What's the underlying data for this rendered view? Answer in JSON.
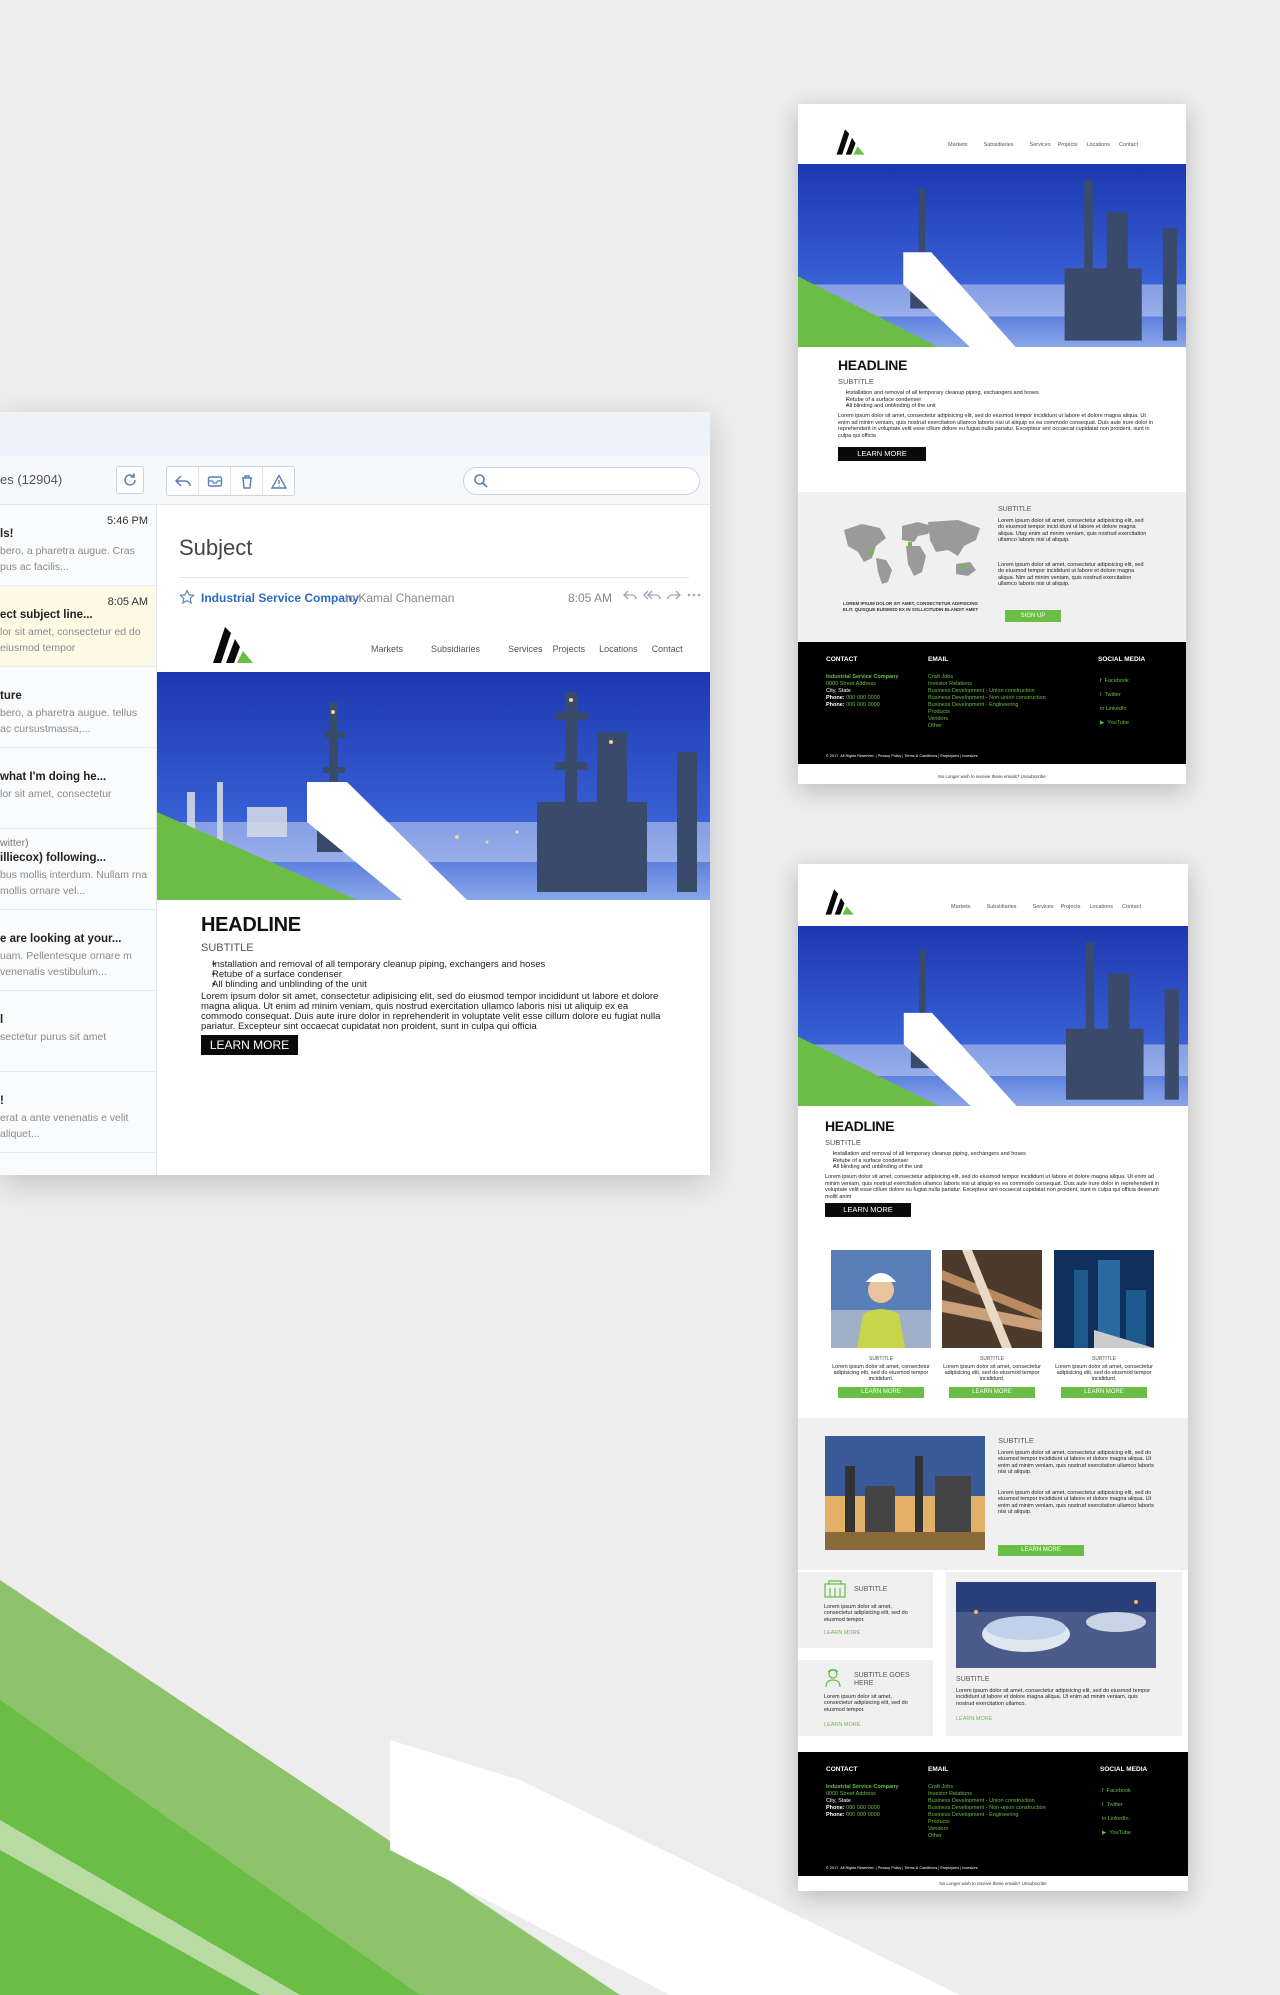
{
  "colors": {
    "brand_green": "#6abd45",
    "sky_blue": "#1e3fb8",
    "black": "#000000",
    "link_blue": "#2a6bc4"
  },
  "mail": {
    "folder_label": "es (12904)",
    "toolbar": {
      "refresh_icon": "refresh-icon",
      "reply_icon": "reply-icon",
      "archive_icon": "archive-icon",
      "delete_icon": "trash-icon",
      "spam_icon": "warning-icon"
    },
    "search": {
      "placeholder": ""
    },
    "messages": [
      {
        "time": "5:46 PM",
        "subject": "ls!",
        "preview": "bero, a pharetra augue. Cras pus ac facilis..."
      },
      {
        "time": "8:05 AM",
        "subject": "ect subject line...",
        "preview": "lor sit amet, consectetur ed do eiusmod tempor",
        "selected": true
      },
      {
        "subject": "ture",
        "preview": "bero, a pharetra augue. tellus ac cursustmassa,..."
      },
      {
        "subject": "what I'm doing he...",
        "preview": "lor sit amet, consectetur"
      },
      {
        "from": "witter)",
        "subject": "illiecox) following...",
        "preview": "bus mollis interdum. Nullam rna mollis ornare vel..."
      },
      {
        "subject": "e are looking at your...",
        "preview": "uam. Pellentesque ornare m venenatis vestibulum..."
      },
      {
        "subject": "l",
        "preview": "sectetur purus sit amet"
      },
      {
        "subject": "!",
        "preview": "erat a ante venenatis e velit aliquet..."
      }
    ],
    "reader": {
      "subject": "Subject",
      "sender": "Industrial Service Company",
      "to": "to Kamal Chaneman",
      "time": "8:05 AM"
    }
  },
  "nav": [
    "Markets",
    "Subsidiaries",
    "Services",
    "Projects",
    "Locations",
    "Contact"
  ],
  "hero": {
    "headline": "HEADLINE",
    "subtitle": "SUBTITLE",
    "bullets": [
      "Installation and removal of all temporary cleanup piping, exchangers and hoses",
      "Retube of a surface condenser",
      "All blinding and unblinding of the unit"
    ],
    "paragraph": "Lorem ipsum dolor sit amet, consectetur adipisicing elit, sed do eiusmod tempor incididunt ut labore et dolore magna aliqua. Ut enim ad minim veniam, quis nostrud exercitation ullamco laboris nisi ut aliquip ex ea commodo consequat. Duis aute irure dolor in reprehenderit in voluptate velit esse cillum dolore eu fugiat nulla pariatur. Excepteur sint occaecat cupidatat non proident, sunt in culpa qui officia",
    "paragraph_long": "Lorem ipsum dolor sit amet, consectetur adipisicing elit, sed do eiusmod tempor incididunt ut labore et dolore magna aliqua. Ut enim ad minim veniam, quis nostrud exercitation ullamco laboris nisi ut aliquip ex ea commodo consequat. Duis aute irure dolor in reprehenderit in voluptate velit esse cillum dolore eu fugiat nulla pariatur. Excepteur sint occaecat cupidatat non proident, sunt in culpa qui officia deserunt mollit anim",
    "cta": "LEARN MORE"
  },
  "map_section": {
    "subtitle": "SUBTITLE",
    "text1": "Lorem ipsum dolor sit amet, consectetur adipisicing elit, sed do eiusmod tempor incid idunt ut labore et dolore magna aliqua. Utay enim ad minim veniam, quis nostrud exercitation ullamco laboris nisi ut aliquip.",
    "text2": "Lorem ipsum dolor sit amet, consectetur adipisicing elit, sed do eiusmod tempor incididunt ut labore et dolore magna aliqua. Nim ad minim veniam, quis nostrud exercitation ullamco laboris nisi ut aliquip.",
    "caption": "LOREM IPSUM DOLOR SIT AMET, CONSECTETUR ADIPISCING ELIT. QUISQUE EUISMOD EX IN SOLLICITUDIN BLANDIT AMET",
    "cta": "SIGN UP"
  },
  "cards": [
    {
      "subtitle": "SUBTITLE",
      "text": "Lorem ipsum dolor sit amet, consectetur adipisicing elit, sed do eiusmod tempor incididunt.",
      "cta": "LEARN MORE"
    },
    {
      "subtitle": "SUBTITLE",
      "text": "Lorem ipsum dolor sit amet, consectetur adipisicing elit, sed do eiusmod tempor incididunt.",
      "cta": "LEARN MORE"
    },
    {
      "subtitle": "SUBTITLE",
      "text": "Lorem ipsum dolor sit amet, consectetur adipisicing elit, sed do eiusmod tempor incididunt.",
      "cta": "LEARN MORE"
    }
  ],
  "plant_section": {
    "subtitle": "SUBTITLE",
    "text1": "Lorem ipsum dolor sit amet, consectetur adipisicing elit, sed do eiusmod tempor incididunt ut labore et dolore magna aliqua. Ut enim ad minim veniam, quis nostrud exercitation ullamco laboris nisi ut aliquip.",
    "text2": "Lorem ipsum dolor sit amet, consectetur adipisicing elit, sed do eiusmod tempor incididunt ut labore et dolore magna aliqua. Ut enim ad minim veniam, quis nostrud exercitation ullamco laboris nisi ut aliquip.",
    "cta": "LEARN MORE"
  },
  "icon_blocks": [
    {
      "icon": "building-icon",
      "title": "SUBTITLE",
      "text": "Lorem ipsum dolor sit amet, consectetur adipisicing elit, sed do eiusmod tempor.",
      "link": "LEARN MORE"
    },
    {
      "icon": "worker-icon",
      "title": "SUBTITLE GOES HERE",
      "text": "Lorem ipsum dolor sit amet, consectetur adipisicing elit, sed do eiusmod tempor.",
      "link": "LEARN MORE"
    }
  ],
  "tank_section": {
    "subtitle": "SUBTITLE",
    "text": "Lorem ipsum dolor sit amet, consectetur adipisicing elit, sed do eiusmod tempor incididunt ut labore et dolore magna aliqua. Ut enim ad minim veniam, quis nostrud exercitation ullamco.",
    "link": "LEARN MORE"
  },
  "footer": {
    "contact_heading": "CONTACT",
    "email_heading": "EMAIL",
    "social_heading": "SOCIAL MEDIA",
    "company": "Industrial Service Company",
    "address": "0000 Street Address",
    "city": "City, State",
    "phone1_label": "Phone:",
    "phone1": "000 000 0000",
    "phone2_label": "Phone:",
    "phone2": "000 000 0000",
    "email_links": [
      "Craft Jobs",
      "Investor Relations",
      "Business Development - Union construction",
      "Business Development - Non-union construction",
      "Business Development - Engineering",
      "Products",
      "Vendors",
      "Other"
    ],
    "social": [
      {
        "icon": "facebook-icon",
        "label": "Facebook"
      },
      {
        "icon": "twitter-icon",
        "label": "Twitter"
      },
      {
        "icon": "linkedin-icon",
        "label": "LinkedIn"
      },
      {
        "icon": "youtube-icon",
        "label": "YouTube"
      }
    ],
    "legal": "© 2017. All Rights Reserved. | Privacy Policy | Terms & Conditions | Employees | Investors",
    "unsubscribe": "No Longer wish to receive these emails? Unsubscribe"
  }
}
